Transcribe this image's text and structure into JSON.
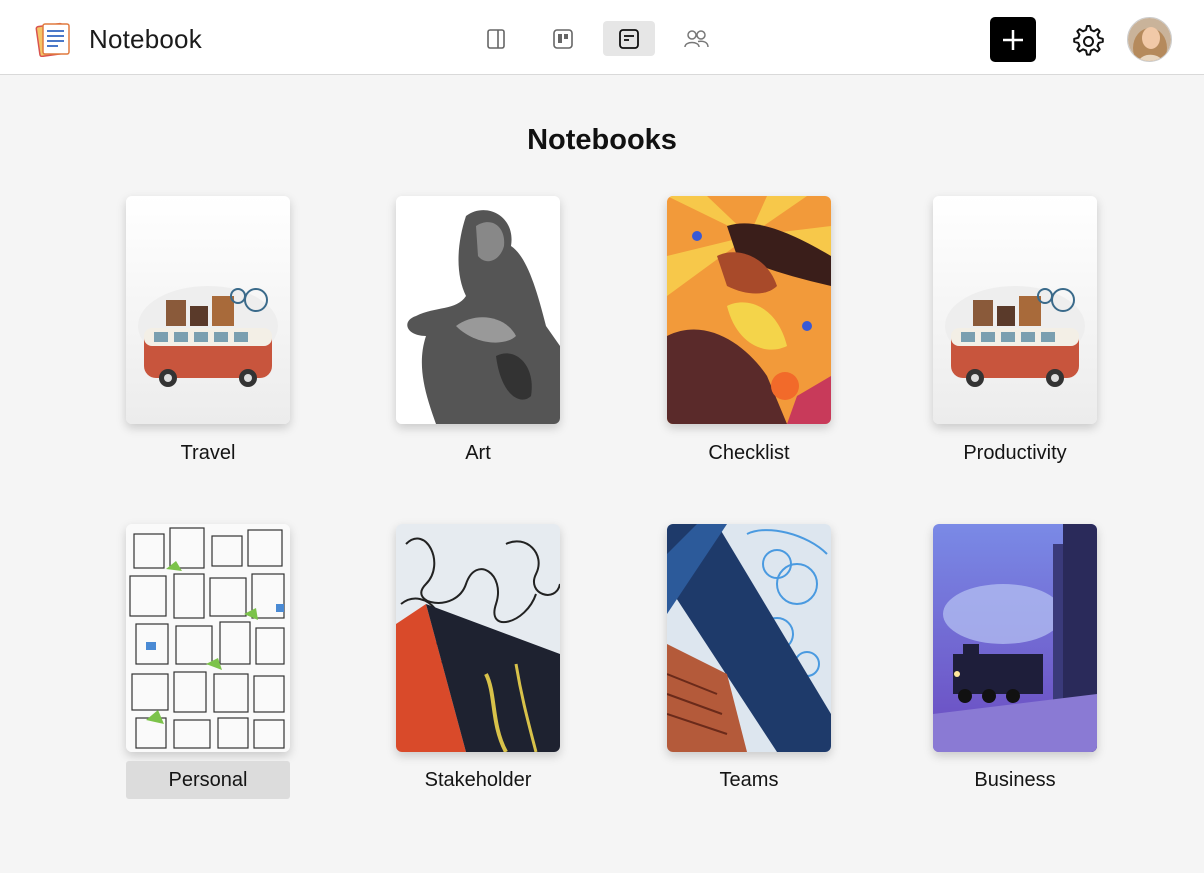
{
  "header": {
    "app_title": "Notebook",
    "logo_icon": "notebook-logo-icon",
    "views": [
      {
        "name": "sidebar-view",
        "icon": "panel-icon",
        "active": false
      },
      {
        "name": "board-view",
        "icon": "board-icon",
        "active": false
      },
      {
        "name": "notebook-view",
        "icon": "note-icon",
        "active": true
      },
      {
        "name": "people-view",
        "icon": "people-icon",
        "active": false
      }
    ],
    "add_icon": "plus-icon",
    "settings_icon": "gear-icon",
    "avatar_icon": "avatar"
  },
  "main": {
    "title": "Notebooks",
    "notebooks": [
      {
        "label": "Travel",
        "cover": "van-illustration",
        "selected": false
      },
      {
        "label": "Art",
        "cover": "statue-engraving",
        "selected": false
      },
      {
        "label": "Checklist",
        "cover": "sunburst-woman",
        "selected": false
      },
      {
        "label": "Productivity",
        "cover": "van-illustration",
        "selected": false
      },
      {
        "label": "Personal",
        "cover": "city-sketch",
        "selected": true
      },
      {
        "label": "Stakeholder",
        "cover": "paint-texture-red-yellow",
        "selected": false
      },
      {
        "label": "Teams",
        "cover": "paint-texture-blue",
        "selected": false
      },
      {
        "label": "Business",
        "cover": "night-train",
        "selected": false
      }
    ]
  },
  "colors": {
    "accent": "#000000",
    "selected_label_bg": "#dcdcdc",
    "background": "#f5f5f5"
  }
}
